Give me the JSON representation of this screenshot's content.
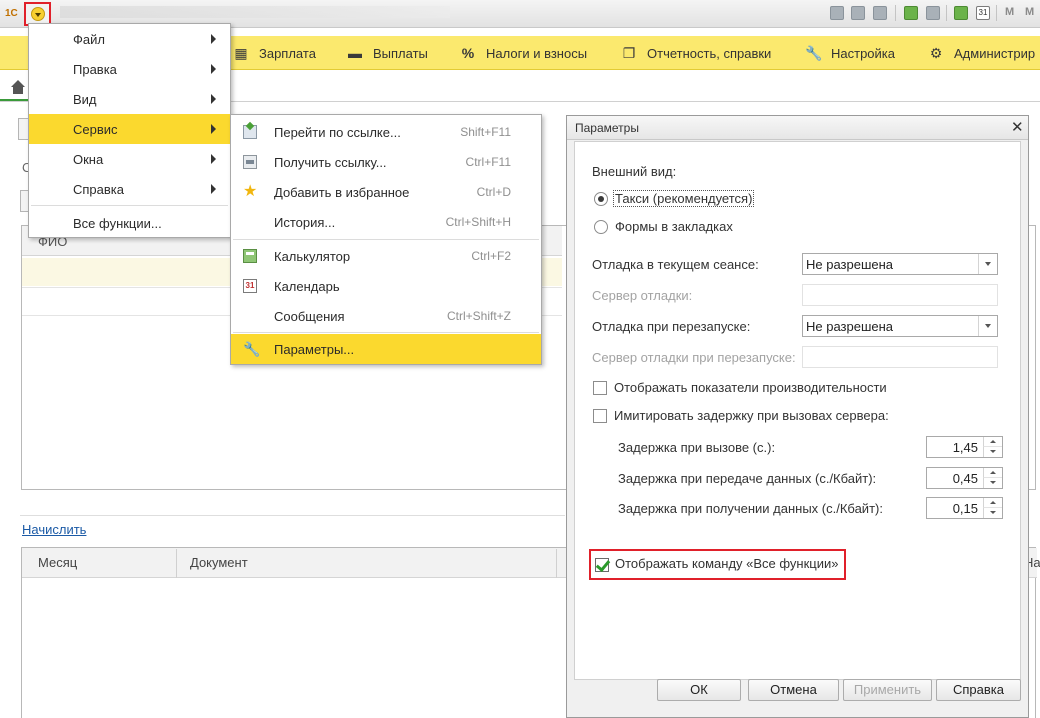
{
  "titlebar": {
    "logo": "1С",
    "letters": [
      "M",
      "M"
    ],
    "calendar_day": "31"
  },
  "sections": [
    {
      "icon": "table-icon",
      "label": "Зарплата"
    },
    {
      "icon": "card-icon",
      "label": "Выплаты"
    },
    {
      "icon": "percent-icon",
      "label": "Налоги и взносы"
    },
    {
      "icon": "reports-icon",
      "label": "Отчетность, справки"
    },
    {
      "icon": "wrench-icon",
      "label": "Настройка"
    },
    {
      "icon": "gear-icon",
      "label": "Администрир"
    }
  ],
  "background": {
    "left_letter": "С",
    "table1_header": "ФИО",
    "accrue_link": "Начислить",
    "table2_columns": [
      "Месяц",
      "Документ",
      "На"
    ]
  },
  "main_menu": {
    "items": [
      {
        "label": "Файл",
        "has_submenu": true
      },
      {
        "label": "Правка",
        "has_submenu": true
      },
      {
        "label": "Вид",
        "has_submenu": true
      },
      {
        "label": "Сервис",
        "has_submenu": true,
        "active": true
      },
      {
        "label": "Окна",
        "has_submenu": true
      },
      {
        "label": "Справка",
        "has_submenu": true
      }
    ],
    "all_functions": "Все функции..."
  },
  "service_menu": {
    "items": [
      {
        "icon": "link-go-icon",
        "label": "Перейти по ссылке...",
        "shortcut": "Shift+F11"
      },
      {
        "icon": "link-get-icon",
        "label": "Получить ссылку...",
        "shortcut": "Ctrl+F11"
      },
      {
        "icon": "star-icon",
        "label": "Добавить в избранное",
        "shortcut": "Ctrl+D"
      },
      {
        "icon": "",
        "label": "История...",
        "shortcut": "Ctrl+Shift+H"
      },
      {
        "icon": "calculator-icon",
        "label": "Калькулятор",
        "shortcut": "Ctrl+F2"
      },
      {
        "icon": "calendar-icon",
        "label": "Календарь",
        "shortcut": ""
      },
      {
        "icon": "",
        "label": "Сообщения",
        "shortcut": "Ctrl+Shift+Z"
      },
      {
        "icon": "wrench-icon",
        "label": "Параметры...",
        "shortcut": "",
        "active": true
      }
    ]
  },
  "params_dialog": {
    "title": "Параметры",
    "appearance_label": "Внешний вид:",
    "radio_taxi": "Такси (рекомендуется)",
    "radio_tabs": "Формы в закладках",
    "debug_session_label": "Отладка в текущем сеансе:",
    "debug_session_value": "Не разрешена",
    "debug_server_label": "Сервер отладки:",
    "debug_restart_label": "Отладка при перезапуске:",
    "debug_restart_value": "Не разрешена",
    "debug_restart_server_label": "Сервер отладки при перезапуске:",
    "show_perf_label": "Отображать показатели производительности",
    "show_perf_checked": false,
    "emulate_delay_label": "Имитировать задержку при вызовах сервера:",
    "emulate_delay_checked": false,
    "delay_call_label": "Задержка при вызове (с.):",
    "delay_call_value": "1,45",
    "delay_send_label": "Задержка при передаче данных (с./Кбайт):",
    "delay_send_value": "0,45",
    "delay_recv_label": "Задержка при получении данных (с./Кбайт):",
    "delay_recv_value": "0,15",
    "show_all_functions_label": "Отображать команду «Все функции»",
    "show_all_functions_checked": true,
    "buttons": {
      "ok": "ОК",
      "cancel": "Отмена",
      "apply": "Применить",
      "help": "Справка"
    }
  },
  "colors": {
    "menu_highlight": "#fbd92e",
    "sections_bar": "#fbe96e",
    "annotation_red": "#e0202a",
    "link": "#1b5aa6"
  }
}
